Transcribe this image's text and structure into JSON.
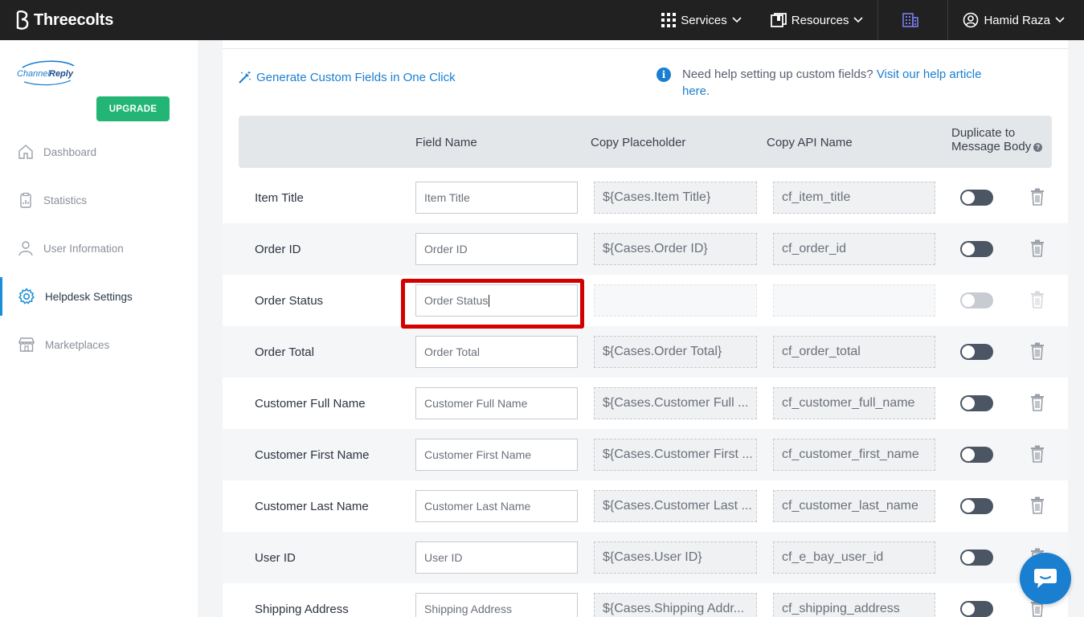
{
  "topbar": {
    "brand": "Threecolts",
    "services_label": "Services",
    "resources_label": "Resources",
    "user_name": "Hamid Raza"
  },
  "sidebar": {
    "logo_text": "ChannelReply",
    "upgrade_label": "UPGRADE",
    "items": [
      {
        "label": "Dashboard",
        "icon": "home-icon"
      },
      {
        "label": "Statistics",
        "icon": "clipboard-icon"
      },
      {
        "label": "User Information",
        "icon": "user-icon"
      },
      {
        "label": "Helpdesk Settings",
        "icon": "gear-icon",
        "active": true
      },
      {
        "label": "Marketplaces",
        "icon": "store-icon"
      }
    ]
  },
  "main": {
    "generate_link": "Generate Custom Fields in One Click",
    "help_text": "Need help setting up custom fields?",
    "help_link": "Visit our help article here",
    "help_period": "."
  },
  "table": {
    "headers": {
      "field_name": "Field Name",
      "copy_placeholder": "Copy Placeholder",
      "copy_api_name": "Copy API Name",
      "duplicate_line1": "Duplicate to",
      "duplicate_line2": "Message Body"
    },
    "rows": [
      {
        "label": "Item Title",
        "field": "Item Title",
        "placeholder": "${Cases.Item Title}",
        "api": "cf_item_title",
        "toggle": "off"
      },
      {
        "label": "Order ID",
        "field": "Order ID",
        "placeholder": "${Cases.Order ID}",
        "api": "cf_order_id",
        "toggle": "off"
      },
      {
        "label": "Order Status",
        "field": "Order Status",
        "placeholder": "",
        "api": "",
        "toggle": "disabled"
      },
      {
        "label": "Order Total",
        "field": "Order Total",
        "placeholder": "${Cases.Order Total}",
        "api": "cf_order_total",
        "toggle": "off"
      },
      {
        "label": "Customer Full Name",
        "field": "Customer Full Name",
        "placeholder": "${Cases.Customer Full ...",
        "api": "cf_customer_full_name",
        "toggle": "off"
      },
      {
        "label": "Customer First Name",
        "field": "Customer First Name",
        "placeholder": "${Cases.Customer First ...",
        "api": "cf_customer_first_name",
        "toggle": "off"
      },
      {
        "label": "Customer Last Name",
        "field": "Customer Last Name",
        "placeholder": "${Cases.Customer Last ...",
        "api": "cf_customer_last_name",
        "toggle": "off"
      },
      {
        "label": "User ID",
        "field": "User ID",
        "placeholder": "${Cases.User ID}",
        "api": "cf_e_bay_user_id",
        "toggle": "off"
      },
      {
        "label": "Shipping Address",
        "field": "Shipping Address",
        "placeholder": "${Cases.Shipping Addr...",
        "api": "cf_shipping_address",
        "toggle": "off"
      }
    ]
  },
  "colors": {
    "accent": "#1a7fd0",
    "upgrade": "#22b573",
    "highlight": "#d40000",
    "topbar": "#212121"
  }
}
